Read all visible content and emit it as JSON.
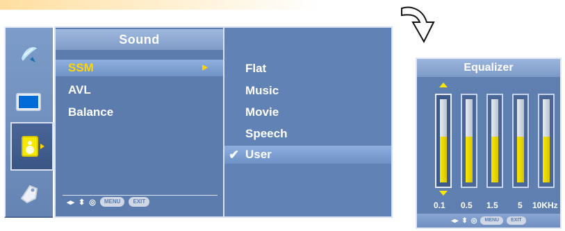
{
  "sound_menu": {
    "title": "Sound",
    "items": [
      "SSM",
      "AVL",
      "Balance"
    ],
    "selected_index": 0
  },
  "ssm_submenu": {
    "items": [
      "Flat",
      "Music",
      "Movie",
      "Speech",
      "User"
    ],
    "selected_index": 4
  },
  "nav_hint": {
    "arrows_lr": "◂▸",
    "arrows_ud": "⬍",
    "ok": "◎",
    "menu_label": "MENU",
    "exit_label": "EXIT"
  },
  "equalizer": {
    "title": "Equalizer",
    "bands": [
      {
        "label": "0.1",
        "level": 0.55
      },
      {
        "label": "0.5",
        "level": 0.55
      },
      {
        "label": "1.5",
        "level": 0.55
      },
      {
        "label": "5",
        "level": 0.55
      },
      {
        "label": "10KHz",
        "level": 0.55
      }
    ],
    "active_band_index": 0
  },
  "colors": {
    "panel_blue": "#5c7cae",
    "highlight_yellow": "#ffd400",
    "eq_fill": "#f2e200"
  },
  "icons": [
    "satellite-icon",
    "screen-icon",
    "speaker-icon",
    "tag-icon",
    "check-icon",
    "curved-arrow-icon"
  ]
}
